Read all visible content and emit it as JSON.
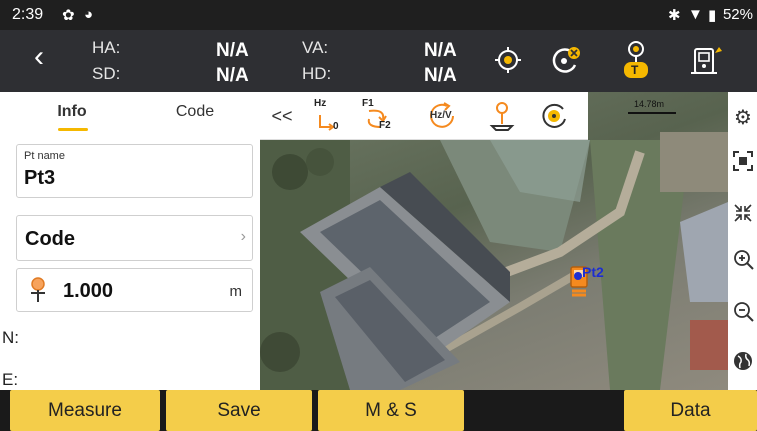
{
  "status_bar": {
    "time": "2:39",
    "battery": "52%",
    "icons": [
      "gear-icon",
      "sync-icon",
      "bluetooth-icon",
      "wifi-icon",
      "battery-icon"
    ]
  },
  "header": {
    "ha_label": "HA:",
    "ha_value": "N/A",
    "va_label": "VA:",
    "va_value": "N/A",
    "sd_label": "SD:",
    "sd_value": "N/A",
    "hd_label": "HD:",
    "hd_value": "N/A",
    "target_badge": "T",
    "accent": "#f5b800"
  },
  "left_panel": {
    "tabs": [
      {
        "label": "Info",
        "active": true
      },
      {
        "label": "Code",
        "active": false
      }
    ],
    "point_name_label": "Pt name",
    "point_name_value": "Pt3",
    "code_value": "Code",
    "target_height_value": "1.000",
    "target_height_unit": "m",
    "n_label": "N:",
    "e_label": "E:"
  },
  "map": {
    "toolbar_collapse": "<<",
    "tool_hz": "Hz",
    "tool_hz_sub": "0",
    "tool_f1": "F1",
    "tool_f2": "F2",
    "tool_hzv": "Hz/V",
    "scale_label": "14.78m",
    "point_label": "Pt2"
  },
  "bottom_bar": {
    "measure": "Measure",
    "save": "Save",
    "measure_save": "M & S",
    "data": "Data",
    "button_color": "#f4cd4a"
  }
}
